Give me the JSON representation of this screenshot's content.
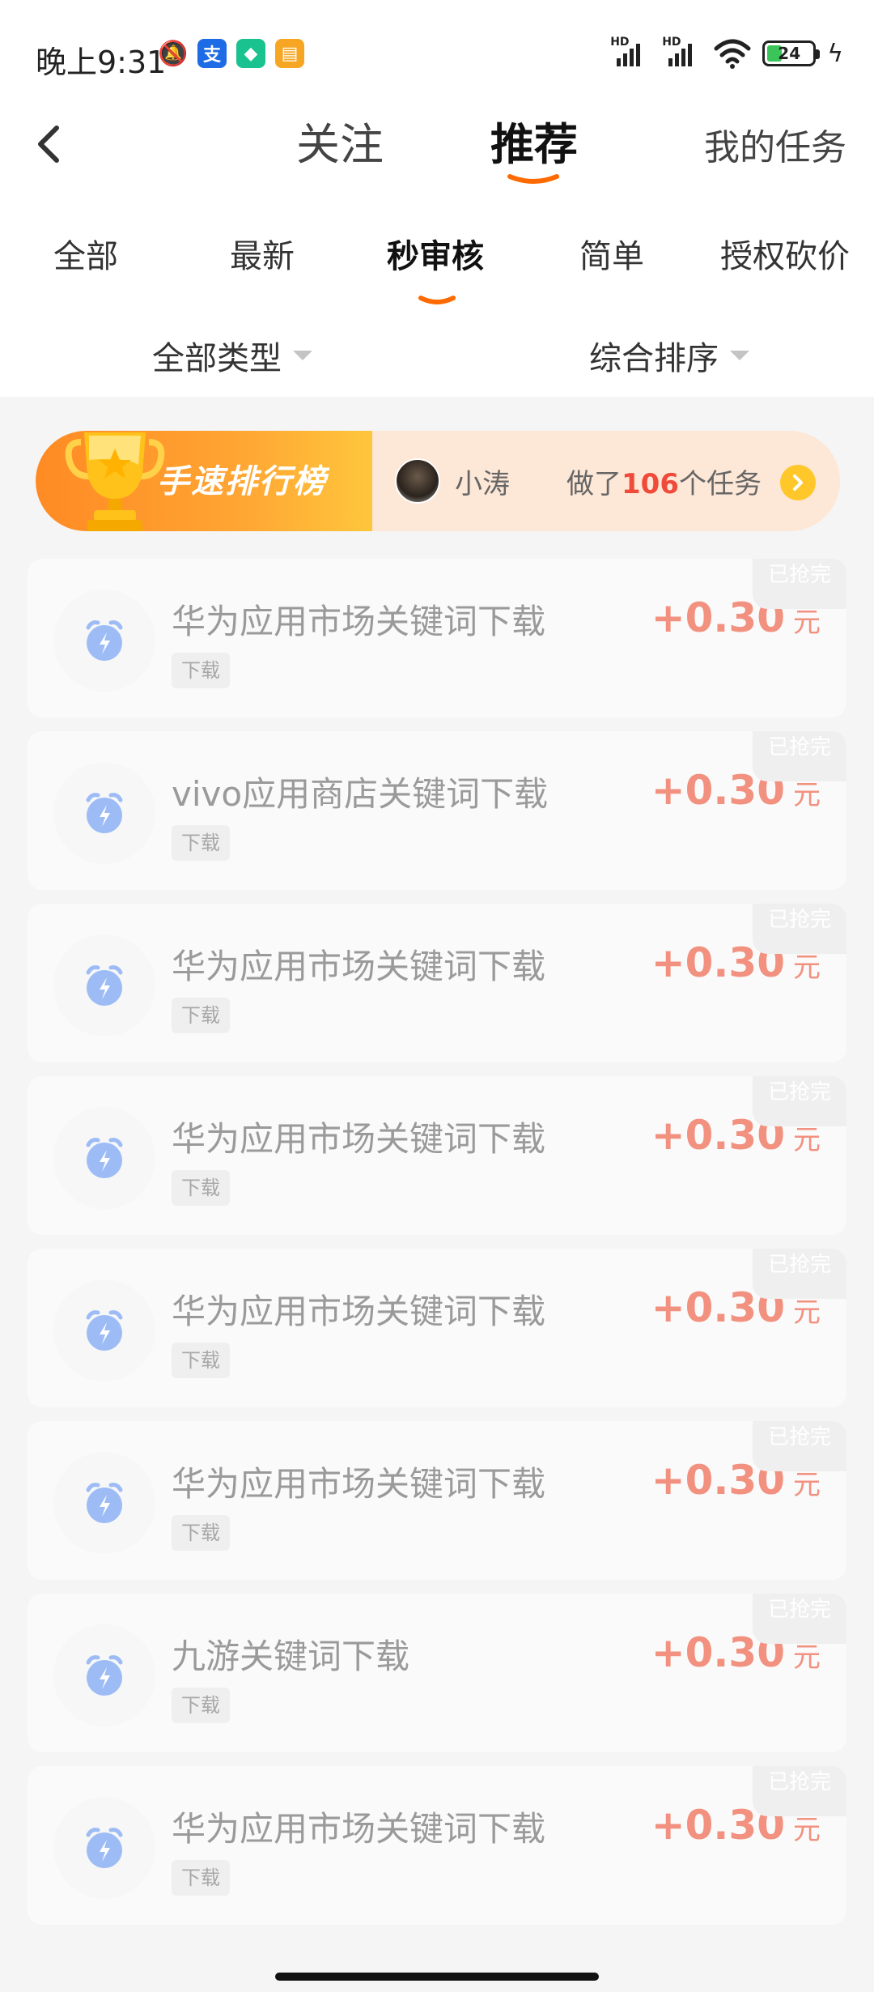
{
  "status_bar": {
    "time": "晚上9:31",
    "battery": "24",
    "network_label": "HD"
  },
  "header": {
    "tabs": [
      {
        "label": "关注"
      },
      {
        "label": "推荐"
      }
    ],
    "active_tab": "推荐",
    "my_tasks": "我的任务"
  },
  "categories": {
    "items": [
      "全部",
      "最新",
      "秒审核",
      "简单",
      "授权砍价"
    ],
    "active": "秒审核"
  },
  "filters": {
    "type": "全部类型",
    "sort": "综合排序"
  },
  "rank_banner": {
    "title": "手速排行榜",
    "user": "小涛",
    "prefix": "做了",
    "count": "106",
    "suffix": "个任务"
  },
  "tasks": [
    {
      "title": "华为应用市场关键词下载",
      "tag": "下载",
      "amount": "+0.30",
      "unit": "元",
      "badge": "已抢完"
    },
    {
      "title": "vivo应用商店关键词下载",
      "tag": "下载",
      "amount": "+0.30",
      "unit": "元",
      "badge": "已抢完"
    },
    {
      "title": "华为应用市场关键词下载",
      "tag": "下载",
      "amount": "+0.30",
      "unit": "元",
      "badge": "已抢完"
    },
    {
      "title": "华为应用市场关键词下载",
      "tag": "下载",
      "amount": "+0.30",
      "unit": "元",
      "badge": "已抢完"
    },
    {
      "title": "华为应用市场关键词下载",
      "tag": "下载",
      "amount": "+0.30",
      "unit": "元",
      "badge": "已抢完"
    },
    {
      "title": "华为应用市场关键词下载",
      "tag": "下载",
      "amount": "+0.30",
      "unit": "元",
      "badge": "已抢完"
    },
    {
      "title": "九游关键词下载",
      "tag": "下载",
      "amount": "+0.30",
      "unit": "元",
      "badge": "已抢完"
    },
    {
      "title": "华为应用市场关键词下载",
      "tag": "下载",
      "amount": "+0.30",
      "unit": "元",
      "badge": "已抢完"
    }
  ],
  "colors": {
    "accent": "#ff6a00",
    "price": "#f2917f",
    "icon_blue": "#9dbcf6"
  }
}
